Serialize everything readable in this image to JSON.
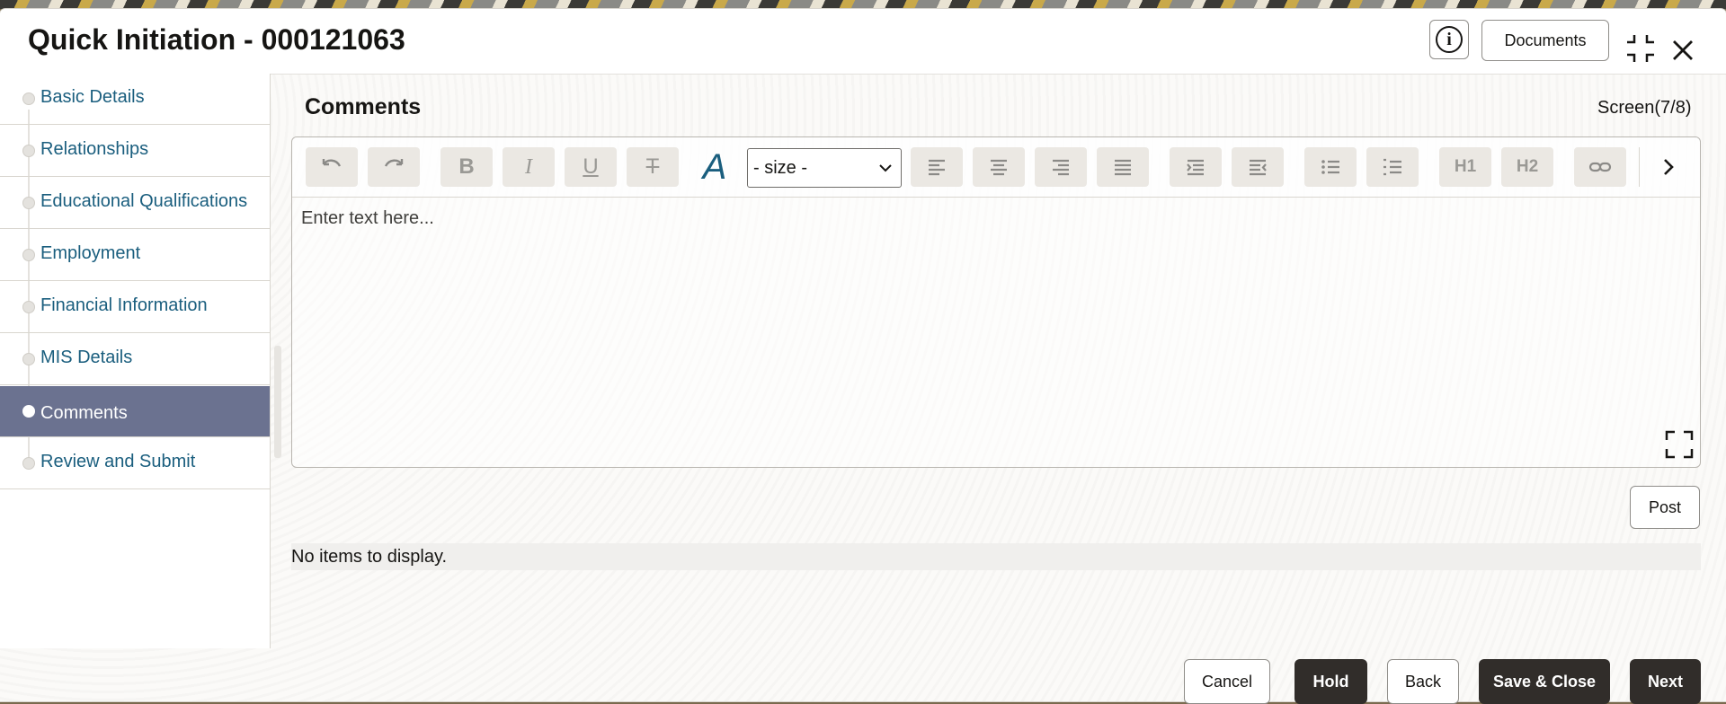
{
  "header": {
    "title": "Quick Initiation - 000121063",
    "info_label": "i",
    "documents_label": "Documents"
  },
  "sidebar": {
    "items": [
      {
        "label": "Basic Details",
        "active": false
      },
      {
        "label": "Relationships",
        "active": false
      },
      {
        "label": "Educational Qualifications",
        "active": false
      },
      {
        "label": "Employment",
        "active": false
      },
      {
        "label": "Financial Information",
        "active": false
      },
      {
        "label": "MIS Details",
        "active": false
      },
      {
        "label": "Comments",
        "active": true
      },
      {
        "label": "Review and Submit",
        "active": false
      }
    ]
  },
  "main": {
    "section_title": "Comments",
    "screen_counter": "Screen(7/8)",
    "editor": {
      "size_select_value": "- size -",
      "placeholder": "Enter text here...",
      "toolbar": {
        "undo_icon": "undo-icon",
        "redo_icon": "redo-icon",
        "bold": "B",
        "italic": "I",
        "underline": "U",
        "strike": "T",
        "font": "A",
        "h1": "H1",
        "h2": "H2"
      }
    },
    "post_label": "Post",
    "empty_message": "No items to display."
  },
  "footer": {
    "cancel": "Cancel",
    "hold": "Hold",
    "back": "Back",
    "save_close": "Save & Close",
    "next": "Next"
  },
  "colors": {
    "active_nav": "#6b7290",
    "nav_text": "#1a5e7e",
    "primary_button": "#312d2a"
  }
}
